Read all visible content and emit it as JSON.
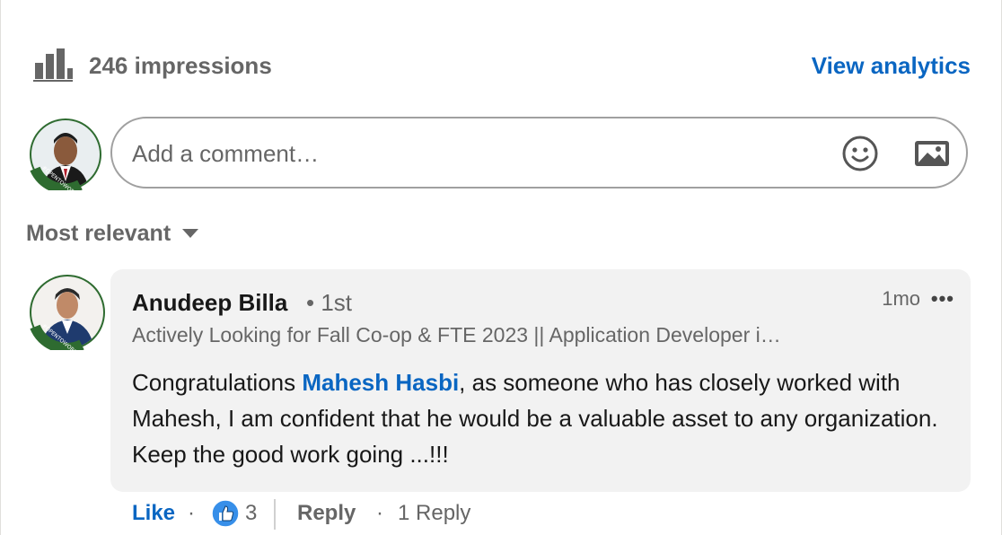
{
  "impressions": {
    "icon": "bar-chart-icon",
    "text": "246 impressions",
    "view_analytics_label": "View analytics"
  },
  "composer": {
    "avatar_badge": "#OPENTOWORK",
    "placeholder": "Add a comment…",
    "emoji_icon": "smiley-face-icon",
    "image_icon": "image-icon"
  },
  "sort": {
    "label": "Most relevant",
    "icon": "caret-down-icon"
  },
  "comment": {
    "avatar_badge": "#OPENTOWORK",
    "author": "Anudeep Billa",
    "degree": "• 1st",
    "headline": "Actively Looking for Fall Co-op & FTE 2023 || Application Developer i…",
    "timestamp": "1mo",
    "more_label": "•••",
    "text_before": "Congratulations ",
    "mention": "Mahesh Hasbi",
    "text_after": ", as someone who has closely worked with Mahesh, I am confident that he would be a valuable asset to any organization. Keep the good work going ...!!!",
    "actions": {
      "like_label": "Like",
      "separator": "·",
      "reaction_icon": "thumbs-up-icon",
      "reaction_count": "3",
      "reply_label": "Reply",
      "reply_count": "1 Reply"
    }
  },
  "colors": {
    "link_blue": "#0a66c2",
    "muted_text": "#666666",
    "bubble_bg": "#f2f2f2",
    "open_to_work_green": "#2e6b30"
  }
}
